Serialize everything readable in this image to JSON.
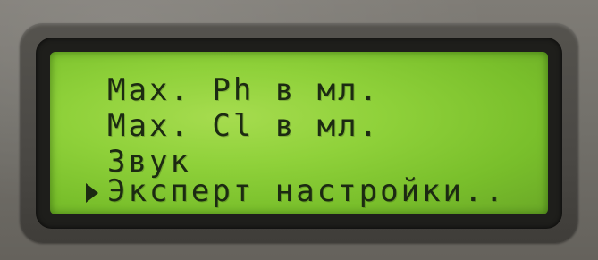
{
  "lcd_menu": {
    "items": [
      {
        "label": "Max. Ph в мл."
      },
      {
        "label": "Max. Cl в мл."
      },
      {
        "label": "Звук"
      },
      {
        "label": "Эксперт настройки.."
      }
    ],
    "selected_index": 3,
    "cursor_icon": "triangle-pointer-icon",
    "colors": {
      "lcd_background": "#8fd13a",
      "lcd_text": "#1c2a12",
      "bezel": "#1e1e1b",
      "housing": "#7d7a74"
    }
  }
}
